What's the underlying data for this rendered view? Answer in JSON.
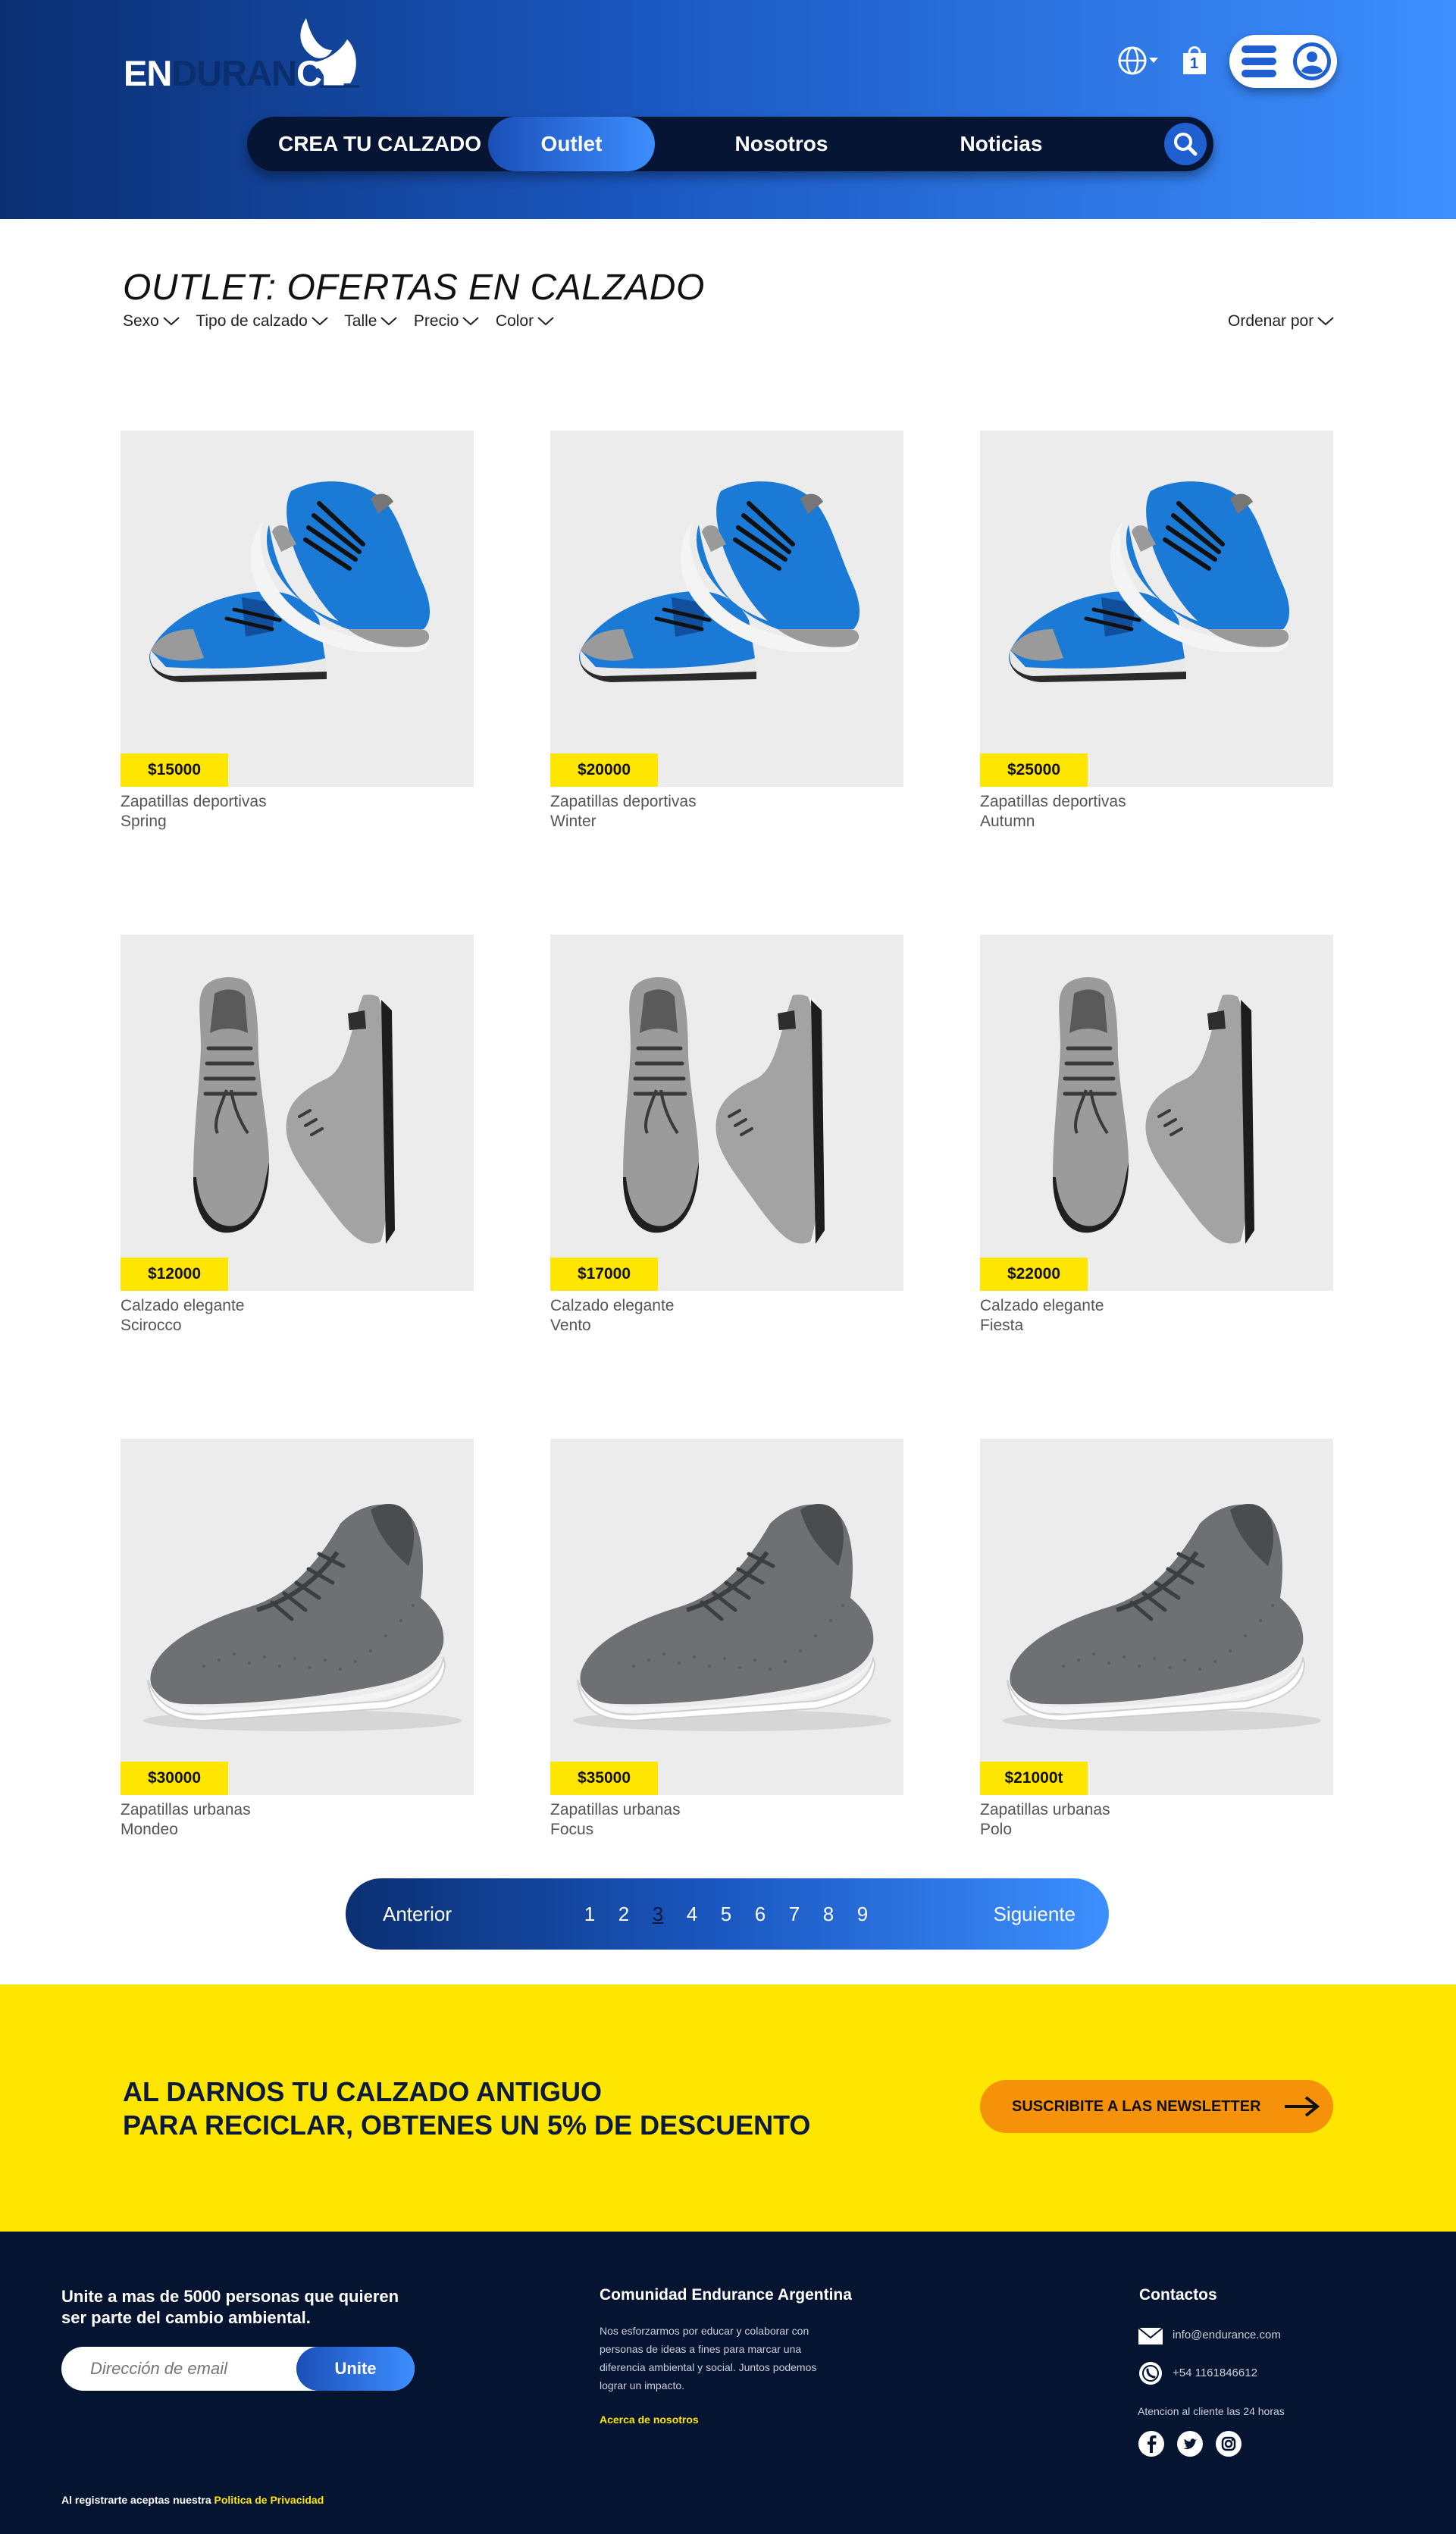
{
  "brand": {
    "logo_part1": "EN",
    "logo_part2": "DURAN",
    "logo_part3": "CE"
  },
  "header": {
    "cart_count": "1",
    "nav": [
      {
        "label": "CREA TU CALZADO"
      },
      {
        "label": "Outlet"
      },
      {
        "label": "Nosotros"
      },
      {
        "label": "Noticias"
      }
    ]
  },
  "main": {
    "title": "OUTLET: OFERTAS EN CALZADO",
    "filters": [
      {
        "label": "Sexo"
      },
      {
        "label": "Tipo de calzado"
      },
      {
        "label": "Talle"
      },
      {
        "label": "Precio"
      },
      {
        "label": "Color"
      }
    ],
    "sort_label": "Ordenar por"
  },
  "products": [
    {
      "price": "$15000",
      "type": "Zapatillas deportivas",
      "name": "Spring",
      "image": "blue-running-shoes"
    },
    {
      "price": "$20000",
      "type": "Zapatillas deportivas",
      "name": "Winter",
      "image": "blue-running-shoes"
    },
    {
      "price": "$25000",
      "type": "Zapatillas deportivas",
      "name": "Autumn",
      "image": "blue-running-shoes"
    },
    {
      "price": "$12000",
      "type": "Calzado elegante",
      "name": "Scirocco",
      "image": "grey-dress-shoes"
    },
    {
      "price": "$17000",
      "type": "Calzado elegante",
      "name": "Vento",
      "image": "grey-dress-shoes"
    },
    {
      "price": "$22000",
      "type": "Calzado elegante",
      "name": "Fiesta",
      "image": "grey-dress-shoes"
    },
    {
      "price": "$30000",
      "type": "Zapatillas urbanas",
      "name": "Mondeo",
      "image": "grey-knit-sneaker"
    },
    {
      "price": "$35000",
      "type": "Zapatillas urbanas",
      "name": "Focus",
      "image": "grey-knit-sneaker"
    },
    {
      "price": "$21000t",
      "type": "Zapatillas urbanas",
      "name": "Polo",
      "image": "grey-knit-sneaker"
    }
  ],
  "pagination": {
    "prev": "Anterior",
    "next": "Siguiente",
    "pages": [
      "1",
      "2",
      "3",
      "4",
      "5",
      "6",
      "7",
      "8",
      "9"
    ],
    "current": "3"
  },
  "promo": {
    "line1": "AL DARNOS TU CALZADO ANTIGUO",
    "line2": "PARA RECICLAR, OBTENES UN 5% DE DESCUENTO",
    "button": "SUSCRIBITE A LAS NEWSLETTER"
  },
  "footer": {
    "join_text": "Unite a mas de 5000 personas que quieren ser parte del cambio ambiental.",
    "email_placeholder": "Dirección de email",
    "join_button": "Unite",
    "privacy_prefix": "Al registrarte aceptas nuestra",
    "privacy_link": "Politica de Privacidad",
    "community_title": "Comunidad Endurance Argentina",
    "community_desc": "Nos esforzarmos por educar y colaborar con personas de ideas a fines para marcar una diferencia ambiental y social. Juntos podemos lograr un impacto.",
    "community_link": "Acerca de nosotros",
    "contact_title": "Contactos",
    "email": "info@endurance.com",
    "phone": "+54 1161846612",
    "hours": "Atencion al cliente las 24 horas",
    "social": [
      "facebook-icon",
      "twitter-icon",
      "instagram-icon"
    ]
  },
  "colors": {
    "accent_yellow": "#ffe600",
    "navy": "#051430",
    "blue": "#1f5fd0",
    "orange": "#f5920a"
  }
}
